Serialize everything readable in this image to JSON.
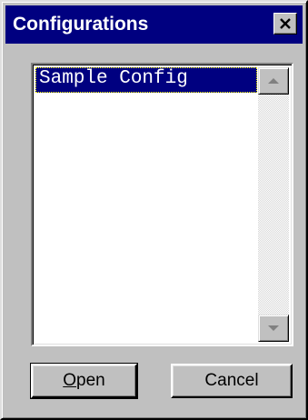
{
  "window": {
    "title": "Configurations",
    "close_icon": "close-icon"
  },
  "config_list": {
    "items": [
      {
        "label": "Sample Config",
        "selected": true
      }
    ],
    "scrollbar": {
      "up_icon": "scroll-up-arrow-icon",
      "down_icon": "scroll-down-arrow-icon"
    }
  },
  "buttons": {
    "open": {
      "mnemonic": "O",
      "rest": "pen"
    },
    "cancel": {
      "label": "Cancel"
    }
  },
  "colors": {
    "titlebar": "#000080",
    "dialog_face": "#c0c0c0",
    "selection": "#000080",
    "selection_text": "#ffffff"
  }
}
